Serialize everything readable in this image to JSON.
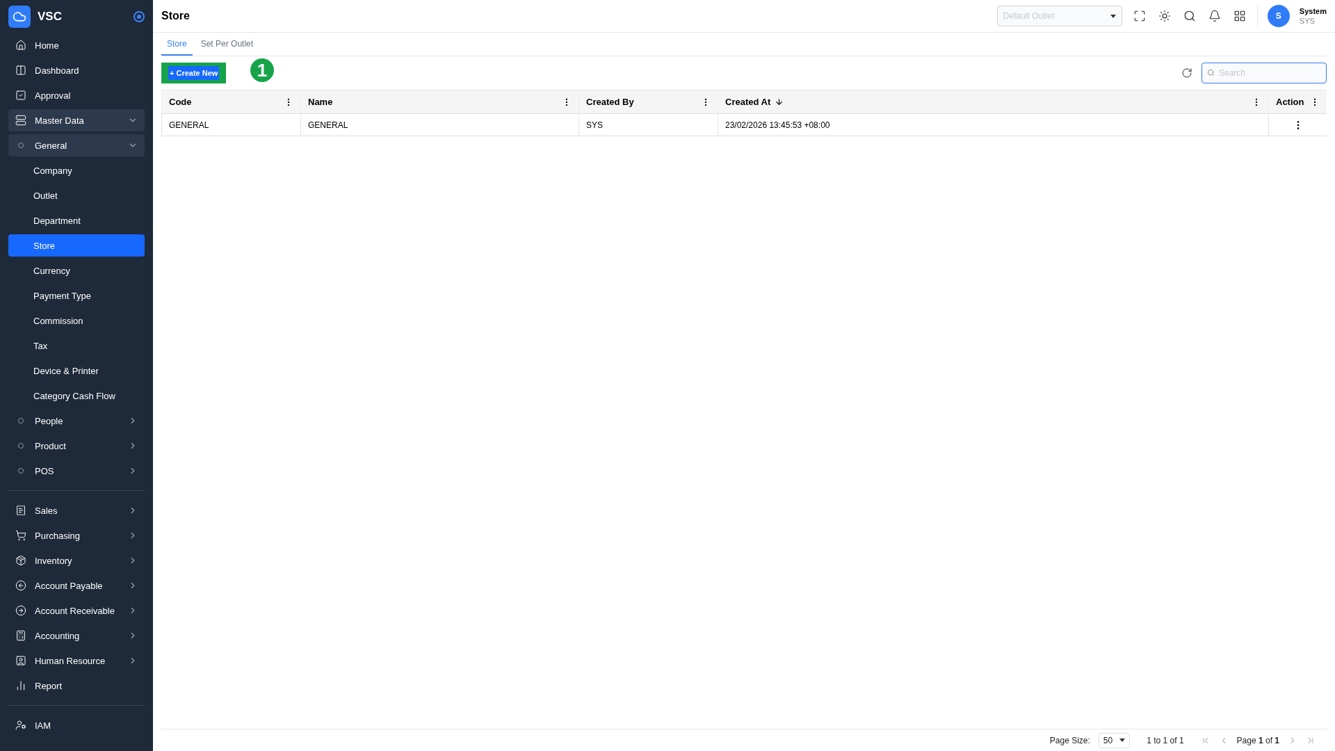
{
  "brand": {
    "name": "VSC"
  },
  "sidebar": {
    "sections": [
      {
        "items": [
          {
            "label": "Home",
            "expanded": false,
            "selected": false
          },
          {
            "label": "Dashboard",
            "expanded": false,
            "selected": false
          },
          {
            "label": "Approval",
            "expanded": false,
            "selected": false
          },
          {
            "label": "Master Data",
            "expandable": true,
            "expanded": true,
            "selected": false,
            "children": [
              {
                "label": "General",
                "expandable": true,
                "expanded": true,
                "selected": false,
                "children": [
                  {
                    "label": "Company",
                    "selected": false
                  },
                  {
                    "label": "Outlet",
                    "selected": false
                  },
                  {
                    "label": "Department",
                    "selected": false
                  },
                  {
                    "label": "Store",
                    "selected": true
                  },
                  {
                    "label": "Currency",
                    "selected": false
                  },
                  {
                    "label": "Payment Type",
                    "selected": false
                  },
                  {
                    "label": "Commission",
                    "selected": false
                  },
                  {
                    "label": "Tax",
                    "selected": false
                  },
                  {
                    "label": "Device & Printer",
                    "selected": false
                  },
                  {
                    "label": "Category Cash Flow",
                    "selected": false
                  }
                ]
              },
              {
                "label": "People",
                "expandable": true,
                "expanded": false,
                "selected": false
              },
              {
                "label": "Product",
                "expandable": true,
                "expanded": false,
                "selected": false
              },
              {
                "label": "POS",
                "expandable": true,
                "expanded": false,
                "selected": false
              }
            ]
          }
        ]
      },
      {
        "items": [
          {
            "label": "Sales",
            "expandable": true,
            "expanded": false,
            "selected": false
          },
          {
            "label": "Purchasing",
            "expandable": true,
            "expanded": false,
            "selected": false
          },
          {
            "label": "Inventory",
            "expandable": true,
            "expanded": false,
            "selected": false
          },
          {
            "label": "Account Payable",
            "expandable": true,
            "expanded": false,
            "selected": false
          },
          {
            "label": "Account Receivable",
            "expandable": true,
            "expanded": false,
            "selected": false
          },
          {
            "label": "Accounting",
            "expandable": true,
            "expanded": false,
            "selected": false
          },
          {
            "label": "Human Resource",
            "expandable": true,
            "expanded": false,
            "selected": false
          },
          {
            "label": "Report",
            "expanded": false,
            "selected": false
          }
        ]
      },
      {
        "items": [
          {
            "label": "IAM",
            "expanded": false,
            "selected": false
          }
        ]
      }
    ]
  },
  "header": {
    "title": "Store",
    "outlet_select": {
      "placeholder": "Default Outlet"
    },
    "user": {
      "initial": "S",
      "name": "System",
      "code": "SYS"
    }
  },
  "tabs": [
    {
      "label": "Store",
      "selected": true
    },
    {
      "label": "Set Per Outlet",
      "selected": false
    }
  ],
  "toolbar": {
    "create_button": "+ Create New",
    "step_badge": "1",
    "search": {
      "placeholder": "Search"
    }
  },
  "table": {
    "columns": [
      {
        "label": "Code",
        "sorted": false
      },
      {
        "label": "Name",
        "sorted": false
      },
      {
        "label": "Created By",
        "sorted": false
      },
      {
        "label": "Created At",
        "sorted": true
      },
      {
        "label": "Action",
        "sorted": false
      }
    ],
    "rows": [
      {
        "cells": [
          "GENERAL",
          "GENERAL",
          "SYS",
          "23/02/2026 13:45:53 +08:00"
        ]
      }
    ]
  },
  "pagination": {
    "page_size_label": "Page Size:",
    "page_size": "50",
    "range": "1 to 1 of 1",
    "page": "Page **1** of **1**"
  }
}
